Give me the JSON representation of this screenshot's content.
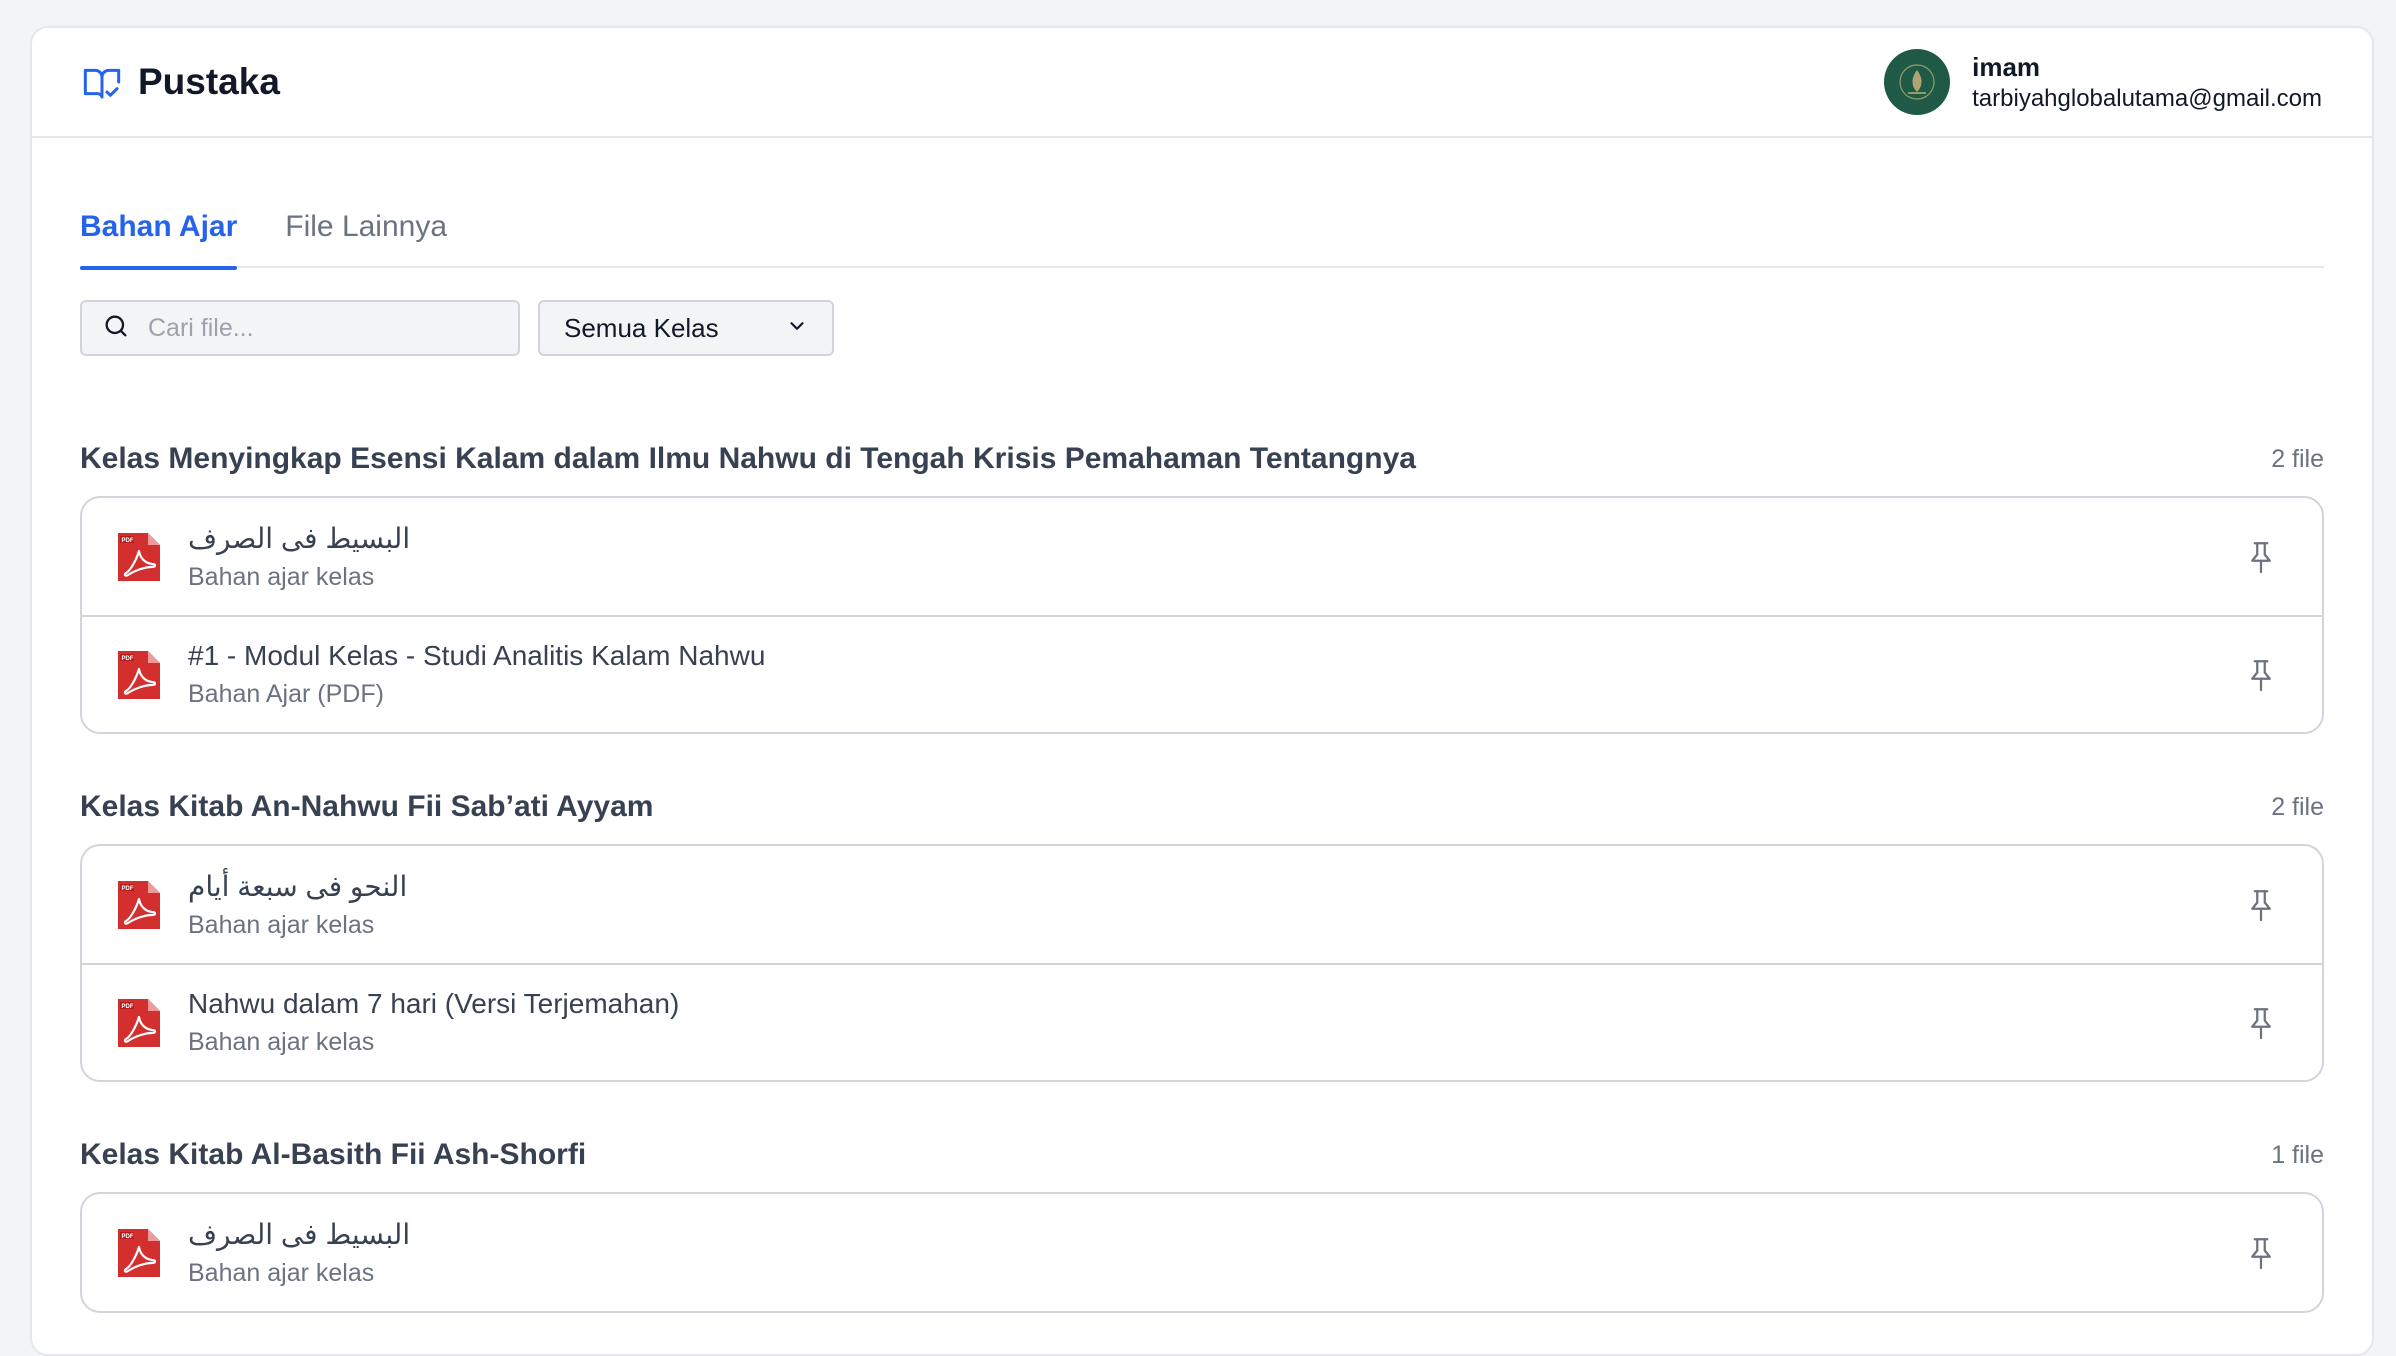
{
  "app": {
    "title": "Pustaka"
  },
  "user": {
    "name": "imam",
    "email": "tarbiyahglobalutama@gmail.com"
  },
  "tabs": [
    {
      "label": "Bahan Ajar",
      "active": true
    },
    {
      "label": "File Lainnya",
      "active": false
    }
  ],
  "search": {
    "placeholder": "Cari file...",
    "value": ""
  },
  "filter": {
    "selected": "Semua Kelas"
  },
  "groups": [
    {
      "title": "Kelas Menyingkap Esensi Kalam dalam Ilmu Nahwu di Tengah Krisis Pemahaman Tentangnya",
      "count": "2 file",
      "files": [
        {
          "title": "البسيط فى الصرف",
          "subtitle": "Bahan ajar kelas",
          "icon": "pdf-icon"
        },
        {
          "title": "#1 - Modul Kelas - Studi Analitis Kalam Nahwu",
          "subtitle": "Bahan Ajar (PDF)",
          "icon": "pdf-icon"
        }
      ]
    },
    {
      "title": "Kelas Kitab An-Nahwu Fii Sab’ati Ayyam",
      "count": "2 file",
      "files": [
        {
          "title": "النحو فى سبعة أيام",
          "subtitle": "Bahan ajar kelas",
          "icon": "pdf-icon"
        },
        {
          "title": "Nahwu dalam 7 hari (Versi Terjemahan)",
          "subtitle": "Bahan ajar kelas",
          "icon": "pdf-icon"
        }
      ]
    },
    {
      "title": "Kelas Kitab Al-Basith Fii Ash-Shorfi",
      "count": "1 file",
      "files": [
        {
          "title": "البسيط فى الصرف",
          "subtitle": "Bahan ajar kelas",
          "icon": "pdf-icon"
        }
      ]
    }
  ],
  "colors": {
    "accent": "#2563eb",
    "pdf": "#d32f2f",
    "avatar": "#1f5a47"
  }
}
